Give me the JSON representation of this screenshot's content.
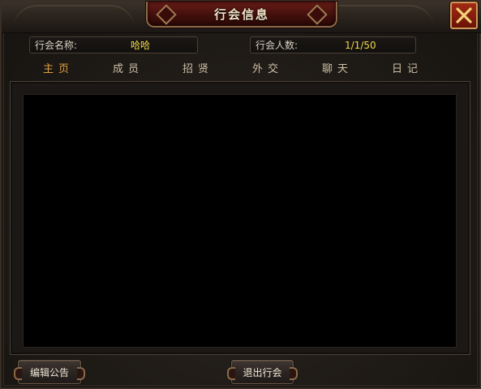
{
  "window": {
    "title": "行会信息",
    "close_icon": "close-x-icon",
    "accent_color": "#e0a040",
    "value_color": "#f1d64a"
  },
  "info": {
    "name_label": "行会名称:",
    "name_value": "哈哈",
    "count_label": "行会人数:",
    "count_value": "1/1/50"
  },
  "tabs": [
    {
      "label": "主页",
      "active": true
    },
    {
      "label": "成员",
      "active": false
    },
    {
      "label": "招贤",
      "active": false
    },
    {
      "label": "外交",
      "active": false
    },
    {
      "label": "聊天",
      "active": false
    },
    {
      "label": "日记",
      "active": false
    }
  ],
  "buttons": {
    "edit_notice": "编辑公告",
    "quit_guild": "退出行会"
  }
}
